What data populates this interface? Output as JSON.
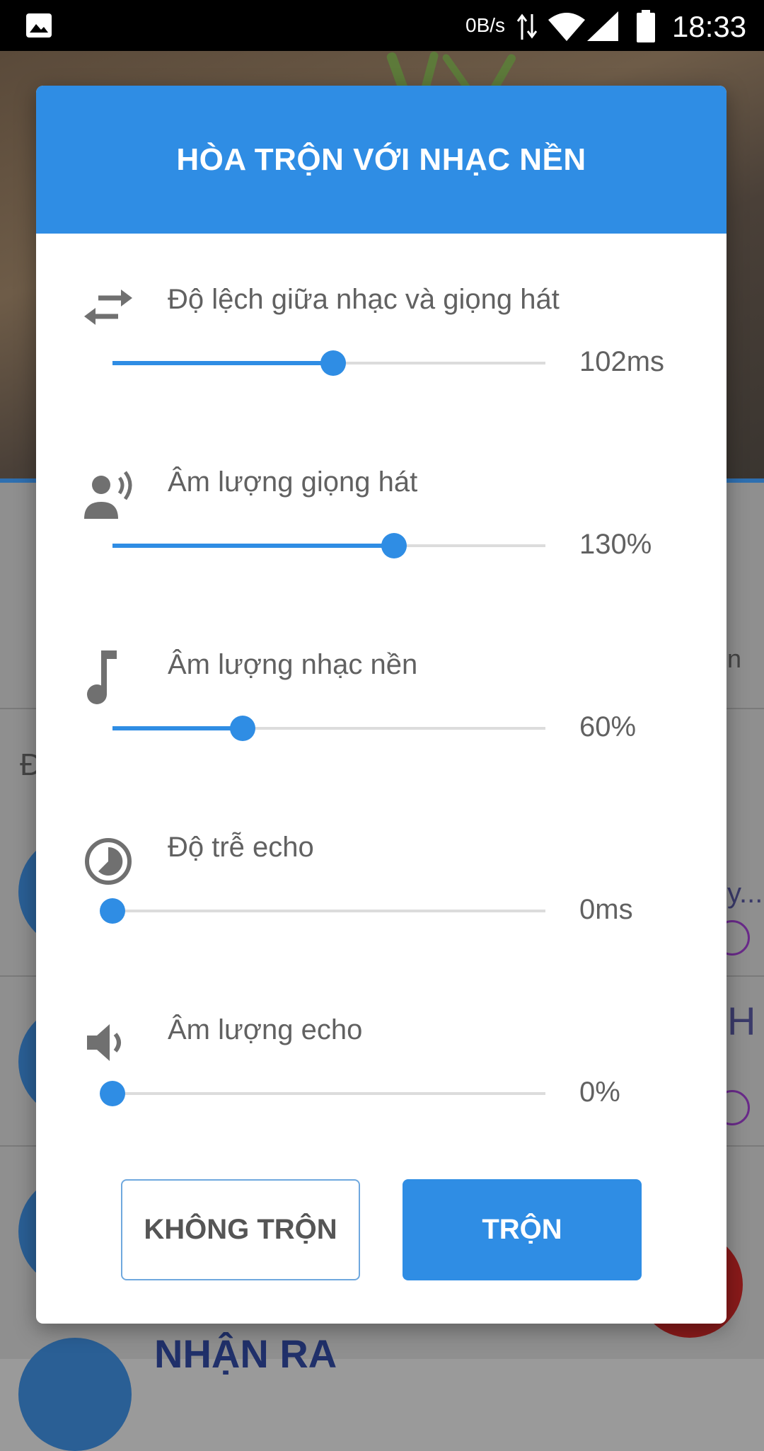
{
  "status_bar": {
    "net_speed": "0B/s",
    "time": "18:33",
    "icons": [
      "gallery-icon",
      "data-transfer-icon",
      "wifi-icon",
      "signal-icon",
      "battery-icon"
    ]
  },
  "background": {
    "fragments": [
      "Đ",
      "n",
      "y...",
      "H",
      "NHẬN RA"
    ]
  },
  "dialog": {
    "title": "HÒA TRỘN VỚI NHẠC NỀN",
    "accent_color": "#2f8de4",
    "rows": [
      {
        "icon": "swap-arrows-icon",
        "label": "Độ lệch giữa nhạc và giọng hát",
        "value": "102ms",
        "level": 0.51
      },
      {
        "icon": "voice-speaking-icon",
        "label": "Âm lượng giọng hát",
        "value": "130%",
        "level": 0.65
      },
      {
        "icon": "music-note-icon",
        "label": "Âm lượng nhạc nền",
        "value": "60%",
        "level": 0.3
      },
      {
        "icon": "timer-icon",
        "label": "Độ trễ echo",
        "value": "0ms",
        "level": 0.0
      },
      {
        "icon": "speaker-icon",
        "label": "Âm lượng echo",
        "value": "0%",
        "level": 0.0
      }
    ],
    "buttons": {
      "cancel": "KHÔNG TRỘN",
      "confirm": "TRỘN"
    }
  }
}
